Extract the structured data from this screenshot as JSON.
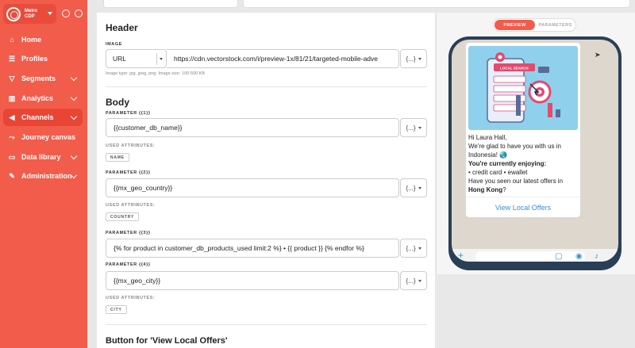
{
  "brand": {
    "name": "Meiro CDP"
  },
  "nav": [
    {
      "label": "Home",
      "icon": "home-icon"
    },
    {
      "label": "Profiles",
      "icon": "profiles-icon"
    },
    {
      "label": "Segments",
      "icon": "filter-icon"
    },
    {
      "label": "Analytics",
      "icon": "chart-icon"
    },
    {
      "label": "Channels",
      "icon": "megaphone-icon"
    },
    {
      "label": "Journey canvas",
      "icon": "journey-icon"
    },
    {
      "label": "Data library",
      "icon": "folder-icon"
    },
    {
      "label": "Administration",
      "icon": "wrench-icon"
    }
  ],
  "form": {
    "header_title": "Header",
    "image_label": "IMAGE",
    "image_type": "URL",
    "image_url": "https://cdn.vectorstock.com/i/preview-1x/81/21/targeted-mobile-adve",
    "image_hint": "Image type: jpg, jpeg, png; Image size: 100-500 KB",
    "body_title": "Body",
    "params": [
      {
        "label": "PARAMETER {{1}}",
        "value": "{{customer_db_name}}",
        "used_label": "USED ATTRIBUTES:",
        "chip": "NAME"
      },
      {
        "label": "PARAMETER {{2}}",
        "value": "{{mx_geo_country}}",
        "used_label": "USED ATTRIBUTES:",
        "chip": "COUNTRY"
      },
      {
        "label": "PARAMETER {{3}}",
        "value": "{% for product in customer_db_products_used limit:2 %} • {{ product }} {% endfor %}"
      },
      {
        "label": "PARAMETER {{4}}",
        "value": "{{mx_geo_city}}",
        "used_label": "USED ATTRIBUTES:",
        "chip": "CITY"
      }
    ],
    "insert_btn": "{...}",
    "button_title": "Button for 'View Local Offers'"
  },
  "preview": {
    "tab_preview": "PREVIEW",
    "tab_parameters": "PARAMETERS",
    "image_badge": "LOCAL SEARCH",
    "msg_line1": "Hi Laura Hall,",
    "msg_line2": "We're glad to have you with us in Indonesia! 🌏",
    "msg_line3": "You're currently enjoying:",
    "msg_line4": "• credit card • ewallet",
    "msg_line5a": "Have you seen our latest offers in ",
    "msg_line5b": "Hong Kong",
    "msg_line5c": "?",
    "button": "View Local Offers"
  },
  "colors": {
    "accent": "#f25c4a",
    "phone": "#2a3f57",
    "link": "#3a8fd4"
  }
}
